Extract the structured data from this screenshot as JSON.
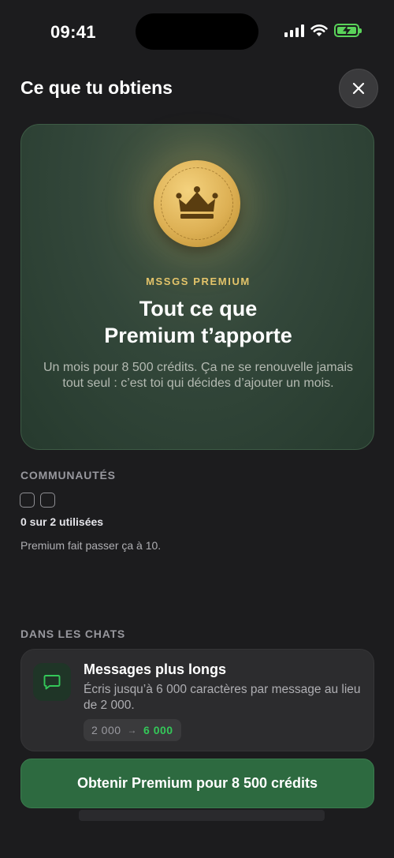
{
  "status_bar": {
    "time": "09:41"
  },
  "header": {
    "title": "Ce que tu obtiens"
  },
  "hero": {
    "eyebrow": "MSSGS PREMIUM",
    "title_line1": "Tout ce que",
    "title_line2": "Premium t’apporte",
    "description": "Un mois pour 8 500 crédits. Ça ne se renouvelle jamais tout seul : c’est toi qui décides d’ajouter un mois."
  },
  "communities": {
    "label": "COMMUNAUTÉS",
    "used": 0,
    "total": 2,
    "usage_text": "0 sur 2 utilisées",
    "upsell_text": "Premium fait passer ça à 10."
  },
  "chats": {
    "label": "DANS LES CHATS",
    "feature": {
      "title": "Messages plus longs",
      "description": "Écris jusqu’à 6 000 caractères par message au lieu de 2 000.",
      "old_limit": "2 000",
      "arrow": "→",
      "new_limit": "6 000"
    }
  },
  "footer": {
    "cta_label": "Obtenir Premium pour 8 500 crédits"
  },
  "colors": {
    "accent_green": "#34c759",
    "cta_green": "#2d6a40",
    "gold": "#e4c46a",
    "background": "#1c1c1e"
  },
  "icons": {
    "close": "close-icon",
    "crown": "crown-icon",
    "chat_bubble": "chat-bubble-icon",
    "signal": "cellular-signal-icon",
    "wifi": "wifi-icon",
    "battery": "battery-charging-icon"
  }
}
